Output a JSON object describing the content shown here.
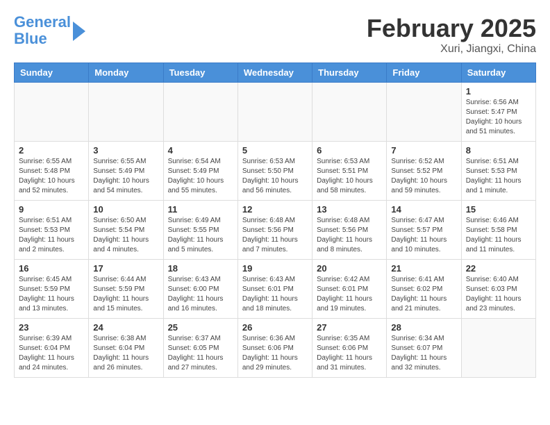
{
  "header": {
    "logo_line1": "General",
    "logo_line2": "Blue",
    "month_title": "February 2025",
    "location": "Xuri, Jiangxi, China"
  },
  "weekdays": [
    "Sunday",
    "Monday",
    "Tuesday",
    "Wednesday",
    "Thursday",
    "Friday",
    "Saturday"
  ],
  "weeks": [
    [
      {
        "day": "",
        "info": ""
      },
      {
        "day": "",
        "info": ""
      },
      {
        "day": "",
        "info": ""
      },
      {
        "day": "",
        "info": ""
      },
      {
        "day": "",
        "info": ""
      },
      {
        "day": "",
        "info": ""
      },
      {
        "day": "1",
        "info": "Sunrise: 6:56 AM\nSunset: 5:47 PM\nDaylight: 10 hours\nand 51 minutes."
      }
    ],
    [
      {
        "day": "2",
        "info": "Sunrise: 6:55 AM\nSunset: 5:48 PM\nDaylight: 10 hours\nand 52 minutes."
      },
      {
        "day": "3",
        "info": "Sunrise: 6:55 AM\nSunset: 5:49 PM\nDaylight: 10 hours\nand 54 minutes."
      },
      {
        "day": "4",
        "info": "Sunrise: 6:54 AM\nSunset: 5:49 PM\nDaylight: 10 hours\nand 55 minutes."
      },
      {
        "day": "5",
        "info": "Sunrise: 6:53 AM\nSunset: 5:50 PM\nDaylight: 10 hours\nand 56 minutes."
      },
      {
        "day": "6",
        "info": "Sunrise: 6:53 AM\nSunset: 5:51 PM\nDaylight: 10 hours\nand 58 minutes."
      },
      {
        "day": "7",
        "info": "Sunrise: 6:52 AM\nSunset: 5:52 PM\nDaylight: 10 hours\nand 59 minutes."
      },
      {
        "day": "8",
        "info": "Sunrise: 6:51 AM\nSunset: 5:53 PM\nDaylight: 11 hours\nand 1 minute."
      }
    ],
    [
      {
        "day": "9",
        "info": "Sunrise: 6:51 AM\nSunset: 5:53 PM\nDaylight: 11 hours\nand 2 minutes."
      },
      {
        "day": "10",
        "info": "Sunrise: 6:50 AM\nSunset: 5:54 PM\nDaylight: 11 hours\nand 4 minutes."
      },
      {
        "day": "11",
        "info": "Sunrise: 6:49 AM\nSunset: 5:55 PM\nDaylight: 11 hours\nand 5 minutes."
      },
      {
        "day": "12",
        "info": "Sunrise: 6:48 AM\nSunset: 5:56 PM\nDaylight: 11 hours\nand 7 minutes."
      },
      {
        "day": "13",
        "info": "Sunrise: 6:48 AM\nSunset: 5:56 PM\nDaylight: 11 hours\nand 8 minutes."
      },
      {
        "day": "14",
        "info": "Sunrise: 6:47 AM\nSunset: 5:57 PM\nDaylight: 11 hours\nand 10 minutes."
      },
      {
        "day": "15",
        "info": "Sunrise: 6:46 AM\nSunset: 5:58 PM\nDaylight: 11 hours\nand 11 minutes."
      }
    ],
    [
      {
        "day": "16",
        "info": "Sunrise: 6:45 AM\nSunset: 5:59 PM\nDaylight: 11 hours\nand 13 minutes."
      },
      {
        "day": "17",
        "info": "Sunrise: 6:44 AM\nSunset: 5:59 PM\nDaylight: 11 hours\nand 15 minutes."
      },
      {
        "day": "18",
        "info": "Sunrise: 6:43 AM\nSunset: 6:00 PM\nDaylight: 11 hours\nand 16 minutes."
      },
      {
        "day": "19",
        "info": "Sunrise: 6:43 AM\nSunset: 6:01 PM\nDaylight: 11 hours\nand 18 minutes."
      },
      {
        "day": "20",
        "info": "Sunrise: 6:42 AM\nSunset: 6:01 PM\nDaylight: 11 hours\nand 19 minutes."
      },
      {
        "day": "21",
        "info": "Sunrise: 6:41 AM\nSunset: 6:02 PM\nDaylight: 11 hours\nand 21 minutes."
      },
      {
        "day": "22",
        "info": "Sunrise: 6:40 AM\nSunset: 6:03 PM\nDaylight: 11 hours\nand 23 minutes."
      }
    ],
    [
      {
        "day": "23",
        "info": "Sunrise: 6:39 AM\nSunset: 6:04 PM\nDaylight: 11 hours\nand 24 minutes."
      },
      {
        "day": "24",
        "info": "Sunrise: 6:38 AM\nSunset: 6:04 PM\nDaylight: 11 hours\nand 26 minutes."
      },
      {
        "day": "25",
        "info": "Sunrise: 6:37 AM\nSunset: 6:05 PM\nDaylight: 11 hours\nand 27 minutes."
      },
      {
        "day": "26",
        "info": "Sunrise: 6:36 AM\nSunset: 6:06 PM\nDaylight: 11 hours\nand 29 minutes."
      },
      {
        "day": "27",
        "info": "Sunrise: 6:35 AM\nSunset: 6:06 PM\nDaylight: 11 hours\nand 31 minutes."
      },
      {
        "day": "28",
        "info": "Sunrise: 6:34 AM\nSunset: 6:07 PM\nDaylight: 11 hours\nand 32 minutes."
      },
      {
        "day": "",
        "info": ""
      }
    ]
  ]
}
